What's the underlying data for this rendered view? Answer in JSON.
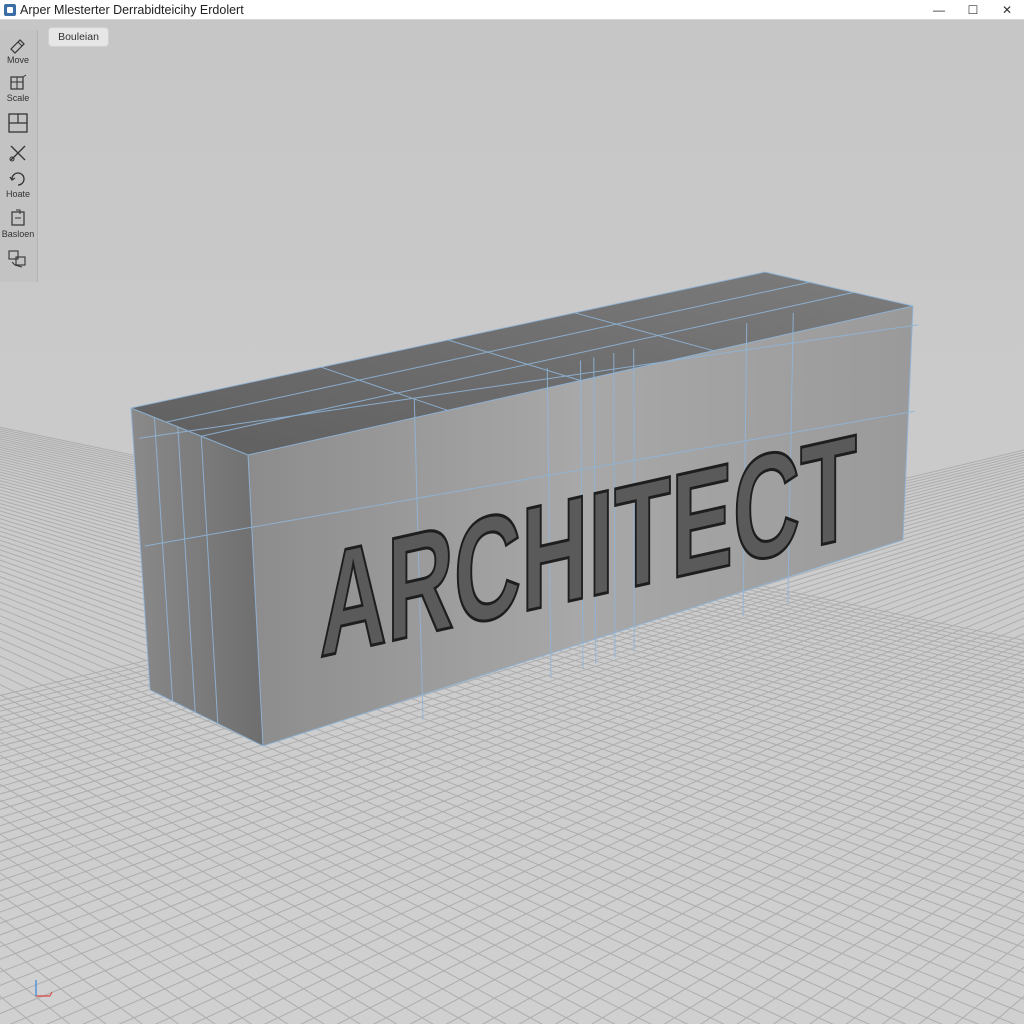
{
  "window": {
    "title": "Arper Mlesterter Derrabidteicihy Erdolert",
    "controls": {
      "minimize": "—",
      "maximize": "☐",
      "close": "✕"
    }
  },
  "toolbar": {
    "tools": [
      {
        "id": "move",
        "label": "Move",
        "icon": "move-icon"
      },
      {
        "id": "scale",
        "label": "Scale",
        "icon": "scale-icon"
      },
      {
        "id": "split",
        "label": "",
        "icon": "split-view-icon"
      },
      {
        "id": "cut",
        "label": "",
        "icon": "cut-icon"
      },
      {
        "id": "rotate",
        "label": "Hoate",
        "icon": "rotate-icon"
      },
      {
        "id": "boolean",
        "label": "Basloen",
        "icon": "boolean-icon"
      },
      {
        "id": "group",
        "label": "",
        "icon": "group-icon"
      }
    ]
  },
  "mode_chip": {
    "label": "Bouleian"
  },
  "viewport": {
    "model_text": "ARCHITECT",
    "colors": {
      "background": "#c9c9c9",
      "grid_line": "#aeaeae",
      "box_top": "#6e6e6e",
      "box_front": "#9a9a9a",
      "box_side": "#808080",
      "wireframe": "#8fb4d8",
      "text_fill": "#5a5a5a",
      "text_stroke": "#1e1e1e"
    }
  },
  "axis_gizmo": {
    "x_color": "#d9534f",
    "y_color": "#4a8fd9"
  }
}
